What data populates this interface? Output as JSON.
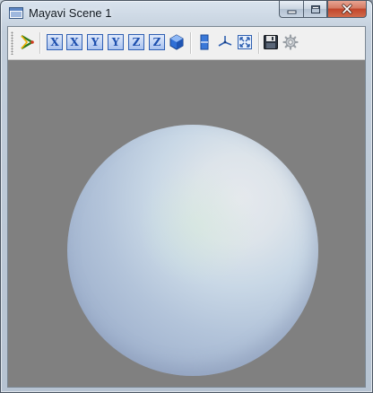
{
  "window": {
    "title": "Mayavi Scene 1",
    "app_icon": "window-app-icon",
    "controls": {
      "minimize": "minimize-icon",
      "maximize": "maximize-icon",
      "close": "close-icon"
    }
  },
  "toolbar": {
    "buttons": [
      {
        "name": "mayavi-pipeline-button",
        "icon": "mayavi-pipeline-icon"
      },
      {
        "name": "view-x-plus-button",
        "label": "X",
        "icon": "view-x-plus-icon"
      },
      {
        "name": "view-x-minus-button",
        "label": "X",
        "icon": "view-x-minus-icon"
      },
      {
        "name": "view-y-plus-button",
        "label": "Y",
        "icon": "view-y-plus-icon"
      },
      {
        "name": "view-y-minus-button",
        "label": "Y",
        "icon": "view-y-minus-icon"
      },
      {
        "name": "view-z-plus-button",
        "label": "Z",
        "icon": "view-z-plus-icon"
      },
      {
        "name": "view-z-minus-button",
        "label": "Z",
        "icon": "view-z-minus-icon"
      },
      {
        "name": "isometric-view-button",
        "icon": "isometric-cube-icon"
      },
      {
        "name": "parallel-projection-button",
        "icon": "parallel-projection-icon"
      },
      {
        "name": "toggle-axes-button",
        "icon": "axes-icon"
      },
      {
        "name": "full-screen-button",
        "icon": "full-screen-icon"
      },
      {
        "name": "save-button",
        "icon": "save-icon"
      },
      {
        "name": "configure-scene-button",
        "icon": "gear-icon"
      }
    ]
  },
  "viewport": {
    "background_color": "#808080",
    "object": "sphere",
    "sphere_color": "#b3c4da"
  }
}
